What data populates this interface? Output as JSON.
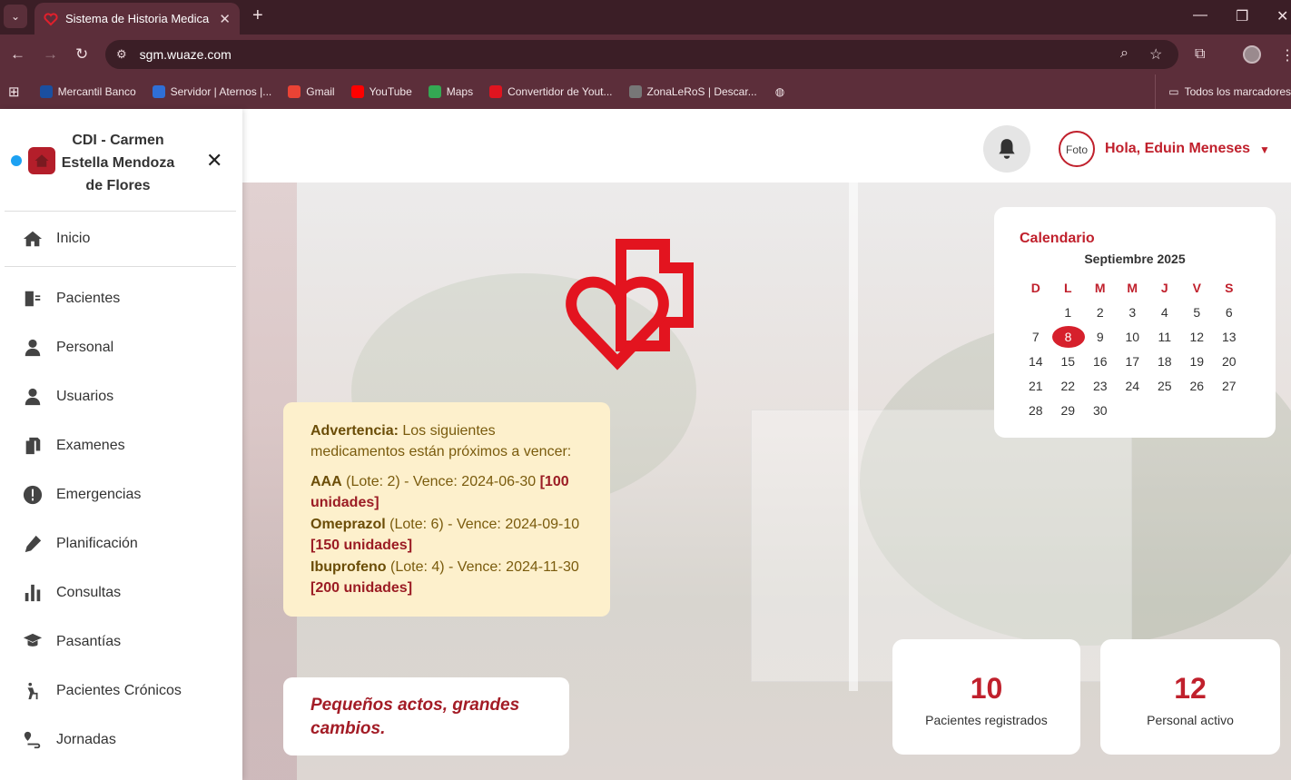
{
  "browser": {
    "tab_title": "Sistema de Historia Medica",
    "url": "sgm.wuaze.com",
    "bookmarks": [
      {
        "label": "Mercantil Banco",
        "color": "#1a4fa0"
      },
      {
        "label": "Servidor | Aternos |...",
        "color": "#2f6fd6"
      },
      {
        "label": "Gmail",
        "color": "#ea4335"
      },
      {
        "label": "YouTube",
        "color": "#ff0000"
      },
      {
        "label": "Maps",
        "color": "#34a853"
      },
      {
        "label": "Convertidor de Yout...",
        "color": "#e0141f"
      },
      {
        "label": "ZonaLeRoS | Descar...",
        "color": "#777777"
      }
    ],
    "all_bookmarks": "Todos los marcadores"
  },
  "sidebar": {
    "title": "CDI - Carmen Estella Mendoza de Flores",
    "home": "Inicio",
    "items": [
      {
        "label": "Pacientes",
        "icon": "patient-card-icon"
      },
      {
        "label": "Personal",
        "icon": "doctor-icon"
      },
      {
        "label": "Usuarios",
        "icon": "user-icon"
      },
      {
        "label": "Examenes",
        "icon": "files-icon"
      },
      {
        "label": "Emergencias",
        "icon": "alert-icon"
      },
      {
        "label": "Planificación",
        "icon": "pen-icon"
      },
      {
        "label": "Consultas",
        "icon": "bars-icon"
      },
      {
        "label": "Pasantías",
        "icon": "graduate-icon"
      },
      {
        "label": "Pacientes Crónicos",
        "icon": "walker-icon"
      },
      {
        "label": "Jornadas",
        "icon": "route-icon"
      }
    ]
  },
  "header": {
    "photo_alt": "Foto",
    "greeting": "Hola, Eduin Meneses"
  },
  "warning": {
    "label": "Advertencia:",
    "text": " Los siguientes medicamentos están próximos a vencer:",
    "meds": [
      {
        "name": "AAA",
        "detail": " (Lote: 2) - Vence: 2024-06-30 ",
        "qty": "[100 unidades]"
      },
      {
        "name": "Omeprazol",
        "detail": " (Lote: 6) - Vence: 2024-09-10 ",
        "qty": "[150 unidades]"
      },
      {
        "name": "Ibuprofeno",
        "detail": " (Lote: 4) - Vence: 2024-11-30 ",
        "qty": "[200 unidades]"
      }
    ]
  },
  "quote": "Pequeños actos, grandes cambios.",
  "calendar": {
    "title": "Calendario",
    "month": "Septiembre 2025",
    "days_header": [
      "D",
      "L",
      "M",
      "M",
      "J",
      "V",
      "S"
    ],
    "first_weekday": 1,
    "days_in_month": 30,
    "today": 8
  },
  "stats": [
    {
      "value": "10",
      "label": "Pacientes registrados"
    },
    {
      "value": "12",
      "label": "Personal activo"
    }
  ],
  "colors": {
    "accent": "#c0202c",
    "chrome": "#5c2e3a"
  }
}
